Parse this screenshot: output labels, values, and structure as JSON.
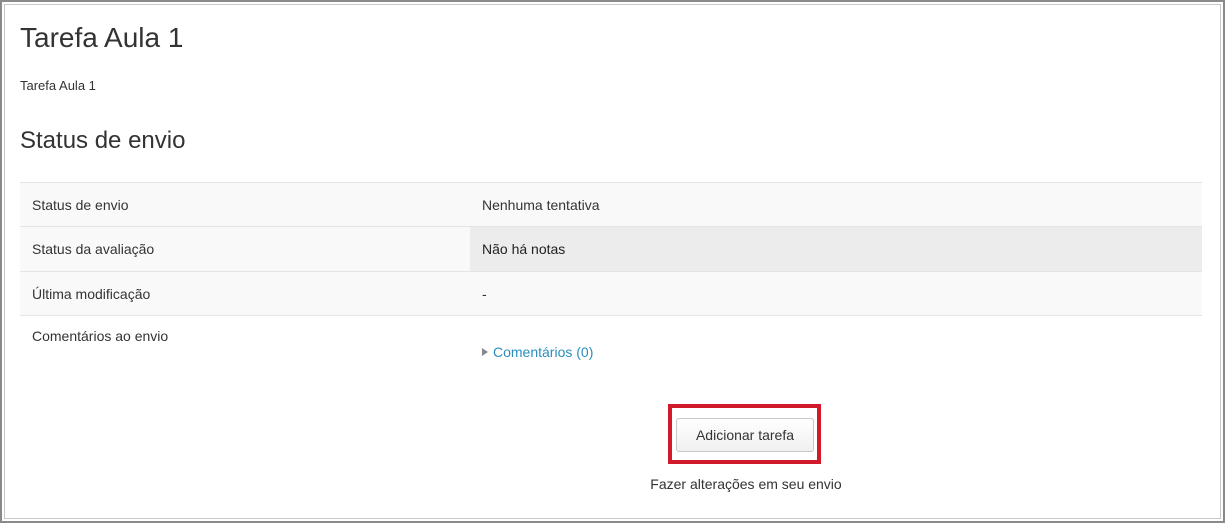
{
  "page": {
    "title": "Tarefa Aula 1",
    "intro": "Tarefa Aula 1"
  },
  "submission": {
    "heading": "Status de envio",
    "rows": [
      {
        "label": "Status de envio",
        "value": "Nenhuma tentativa"
      },
      {
        "label": "Status da avaliação",
        "value": "Não há notas"
      },
      {
        "label": "Última modificação",
        "value": "-"
      },
      {
        "label": "Comentários ao envio",
        "value": "Comentários (0)"
      }
    ]
  },
  "actions": {
    "add_button": "Adicionar tarefa",
    "add_help": "Fazer alterações em seu envio"
  },
  "colors": {
    "link": "#2a8dbd",
    "highlight": "#d0192a"
  },
  "icons": {
    "comments_toggle": "collapsed-triangle-icon"
  }
}
